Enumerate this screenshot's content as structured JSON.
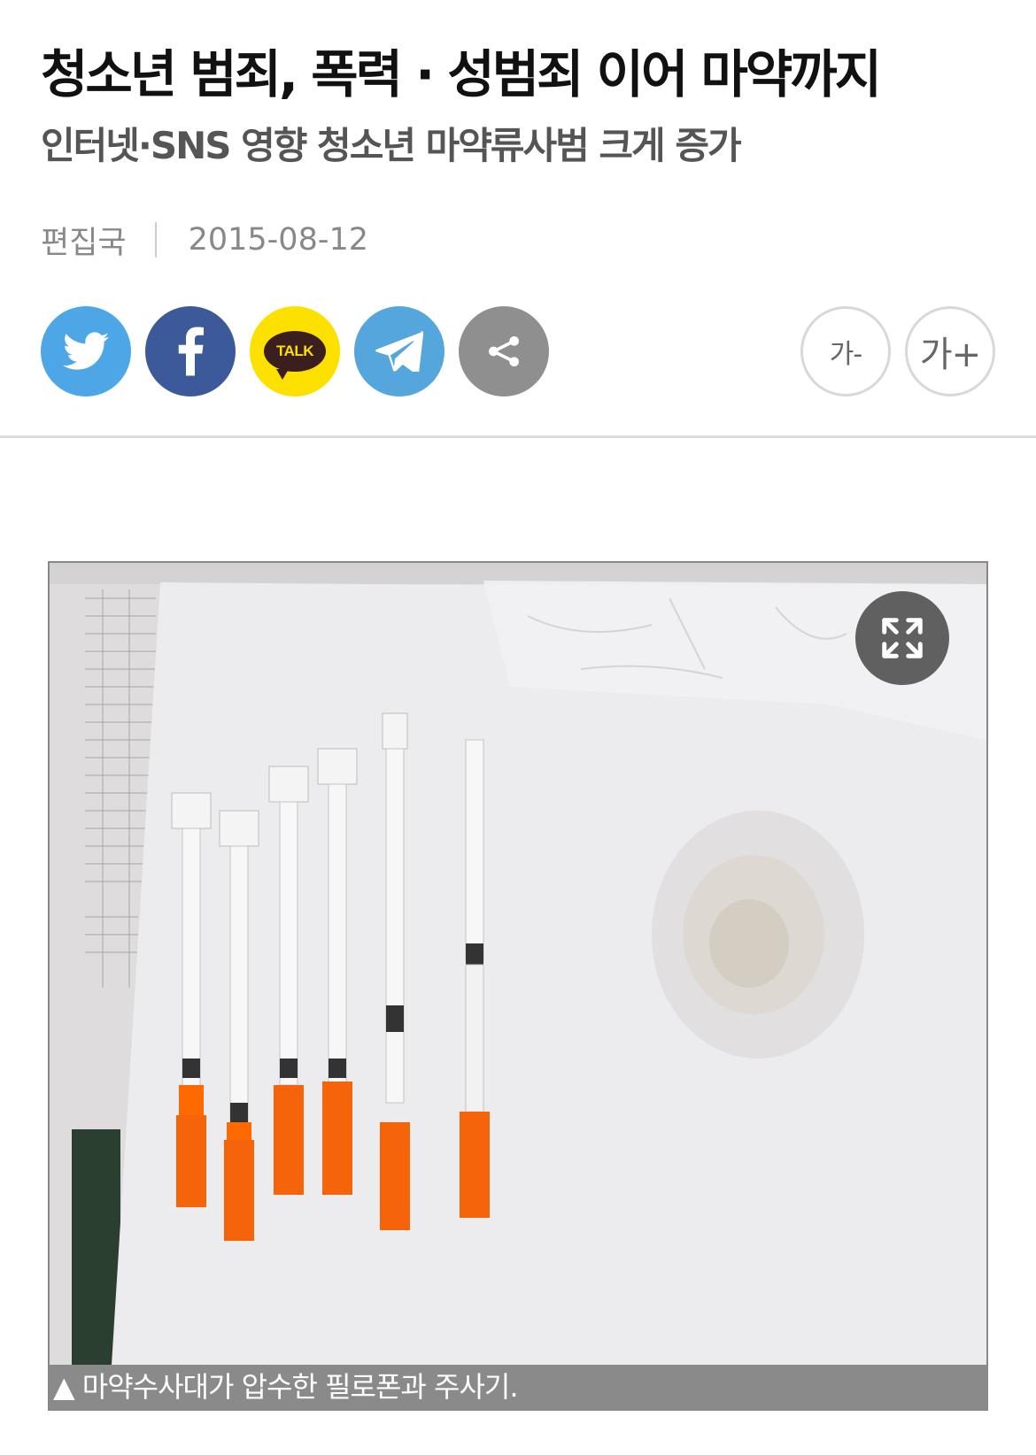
{
  "article": {
    "headline": "청소년 범죄, 폭력 · 성범죄 이어 마약까지",
    "subheadline": "인터넷·SNS 영향 청소년 마약류사범 크게 증가",
    "author": "편집국",
    "date": "2015-08-12"
  },
  "share": {
    "kakao_label": "TALK",
    "buttons": [
      {
        "icon": "twitter-icon",
        "color": "#4da6e6"
      },
      {
        "icon": "facebook-icon",
        "color": "#3c5a9a"
      },
      {
        "icon": "kakaotalk-icon",
        "color": "#fbe000"
      },
      {
        "icon": "telegram-icon",
        "color": "#54a6dd"
      },
      {
        "icon": "share-icon",
        "color": "#8f8f8f"
      }
    ]
  },
  "font_size": {
    "decrease_label": "가-",
    "increase_label": "가+"
  },
  "figure": {
    "expand_icon": "expand-icon",
    "caption": "▲ 마약수사대가 압수한 필로폰과 주사기."
  }
}
